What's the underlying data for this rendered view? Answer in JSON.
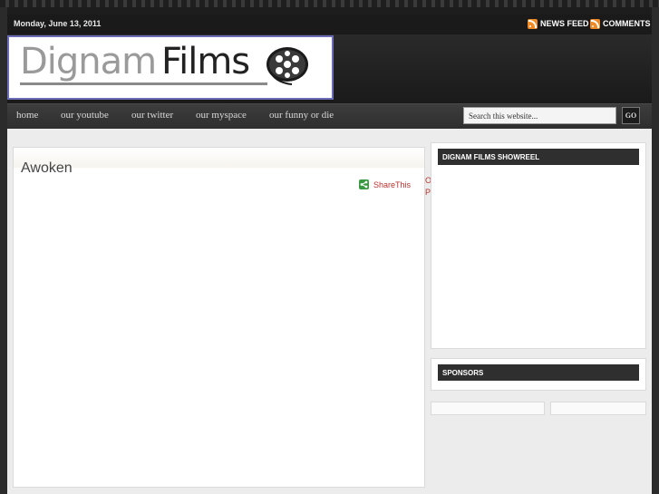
{
  "topbar": {
    "date": "Monday, June 13, 2011",
    "news_feed": "NEWS FEED",
    "comments": "COMMENTS"
  },
  "logo": {
    "part1": "Dignam",
    "part2": "Films"
  },
  "nav": {
    "items": [
      "home",
      "our youtube",
      "our twitter",
      "our myspace",
      "our funny or die"
    ]
  },
  "search": {
    "placeholder": "Search this website...",
    "go_label": "GO"
  },
  "post": {
    "title": "Awoken",
    "share_label": "ShareThis"
  },
  "pager": {
    "older_posts": "Older Posts"
  },
  "sidebar": {
    "showreel_title": "DIGNAM FILMS SHOWREEL",
    "sponsors_title": "SPONSORS"
  },
  "colors": {
    "link": "#b8322d",
    "rss": "#f08a24",
    "share": "#3a9a42",
    "logo_border": "#6b6bb8"
  },
  "icons": [
    "rss-icon",
    "share-icon",
    "film-reel-icon"
  ]
}
